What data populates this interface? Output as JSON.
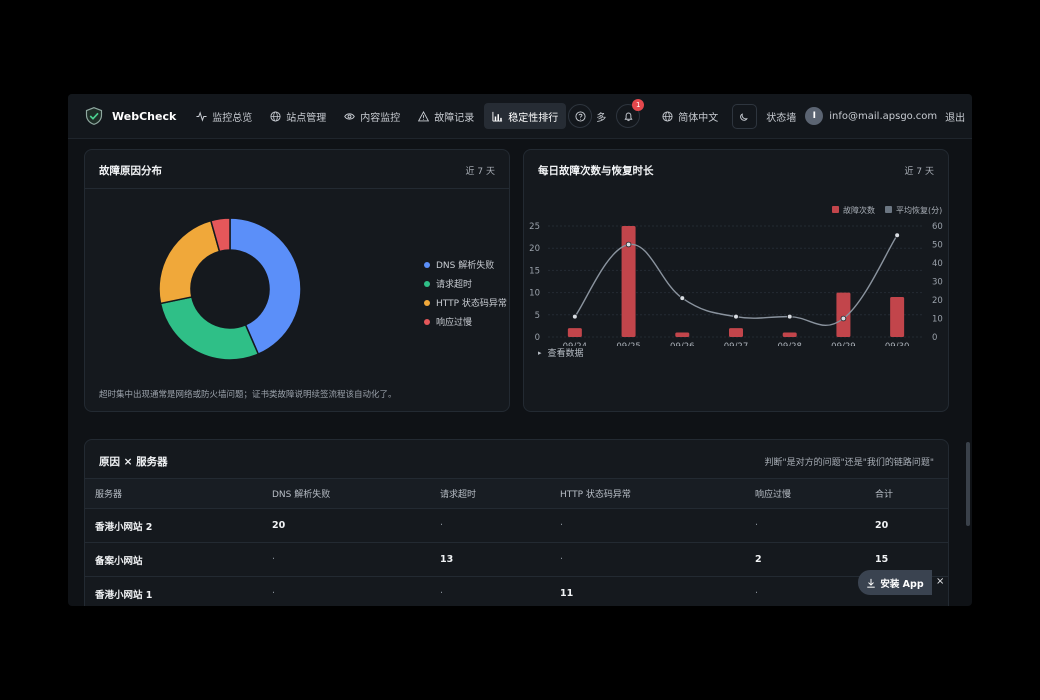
{
  "nav": {
    "brand": "WebCheck",
    "items": [
      {
        "label": "监控总览",
        "icon": "pulse-icon"
      },
      {
        "label": "站点管理",
        "icon": "globe-icon"
      },
      {
        "label": "内容监控",
        "icon": "eye-icon"
      },
      {
        "label": "故障记录",
        "icon": "warning-icon"
      },
      {
        "label": "稳定性排行",
        "icon": "bar-chart-icon",
        "active": true
      }
    ],
    "more_label": "多",
    "notification_count": "1",
    "language": "简体中文",
    "status_wall": "状态墙",
    "avatar_letter": "I",
    "email": "info@mail.apsgo.com",
    "logout": "退出"
  },
  "cause_card": {
    "title": "故障原因分布",
    "extra": "近 7 天",
    "note": "超时集中出现通常是网络或防火墙问题；证书类故障说明续签流程该自动化了。"
  },
  "daily_card": {
    "title": "每日故障次数与恢复时长",
    "extra": "近 7 天",
    "view_data": "查看数据"
  },
  "table_card": {
    "title": "原因 × 服务器",
    "extra": "判断\"是对方的问题\"还是\"我们的链路问题\"",
    "columns": [
      "服务器",
      "DNS 解析失败",
      "请求超时",
      "HTTP 状态码异常",
      "响应过慢",
      "合计"
    ],
    "rows": [
      [
        "香港小网站 2",
        "20",
        "·",
        "·",
        "·",
        "20"
      ],
      [
        "备案小网站",
        "·",
        "13",
        "·",
        "2",
        "15"
      ],
      [
        "香港小网站 1",
        "·",
        "·",
        "11",
        "·",
        ""
      ]
    ]
  },
  "install": {
    "label": "安装 App",
    "close": "×"
  },
  "chart_data": [
    {
      "type": "pie",
      "categories": [
        "DNS 解析失败",
        "请求超时",
        "HTTP 状态码异常",
        "响应过慢"
      ],
      "values": [
        20,
        13,
        11,
        2
      ],
      "colors": [
        "#5b8ff9",
        "#2fbf87",
        "#f0a83a",
        "#e5575a"
      ],
      "legend": "right"
    },
    {
      "type": "bar",
      "categories": [
        "09/24",
        "09/25",
        "09/26",
        "09/27",
        "09/28",
        "09/29",
        "09/30"
      ],
      "series": [
        {
          "name": "故障次数",
          "type": "bar",
          "axis": "left",
          "values": [
            2,
            25,
            1,
            2,
            1,
            10,
            9
          ],
          "color": "#c2454b"
        },
        {
          "name": "平均恢复(分)",
          "type": "line",
          "axis": "right",
          "values": [
            11,
            50,
            21,
            11,
            11,
            10,
            55
          ],
          "color": "#6b7682"
        }
      ],
      "ylim_left": [
        0,
        25
      ],
      "yticks_left": [
        0,
        5,
        10,
        15,
        20,
        25
      ],
      "ylim_right": [
        0,
        60
      ],
      "yticks_right": [
        0,
        10,
        20,
        30,
        40,
        50,
        60
      ],
      "legend": "top-right",
      "grid": true
    }
  ]
}
